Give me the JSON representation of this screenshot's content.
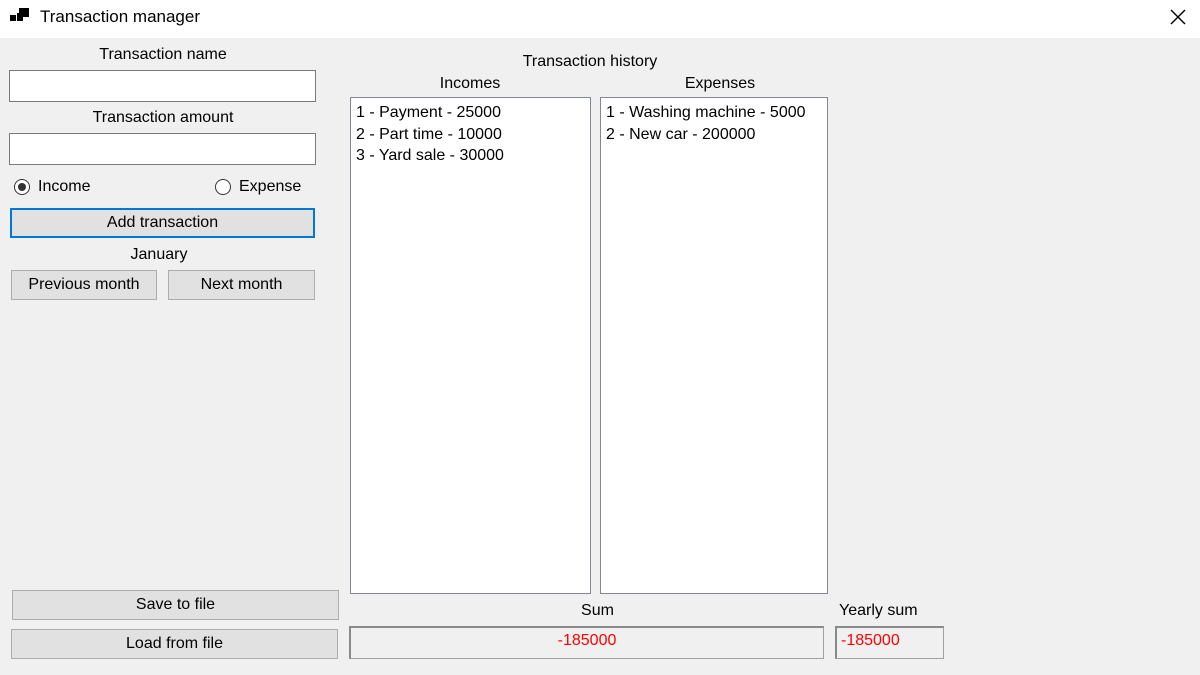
{
  "window": {
    "title": "Transaction manager",
    "app_icon": "window-app-icon",
    "close_icon": "close-icon"
  },
  "left_panel": {
    "name_label": "Transaction name",
    "name_value": "",
    "amount_label": "Transaction amount",
    "amount_value": "",
    "radio_income": "Income",
    "radio_expense": "Expense",
    "selected_type": "Income",
    "add_button": "Add transaction",
    "month_label": "January",
    "prev_month_button": "Previous month",
    "next_month_button": "Next month",
    "save_button": "Save to file",
    "load_button": "Load from file"
  },
  "history": {
    "title": "Transaction history",
    "incomes_label": "Incomes",
    "expenses_label": "Expenses",
    "incomes": [
      "1 - Payment - 25000",
      "2 - Part time - 10000",
      "3 - Yard sale - 30000"
    ],
    "expenses": [
      "1 - Washing machine - 5000",
      "2 - New car - 200000"
    ]
  },
  "totals": {
    "sum_label": "Sum",
    "sum_value": "-185000",
    "yearly_label": "Yearly sum",
    "yearly_value": "-185000",
    "negative_color": "#ff0000"
  }
}
